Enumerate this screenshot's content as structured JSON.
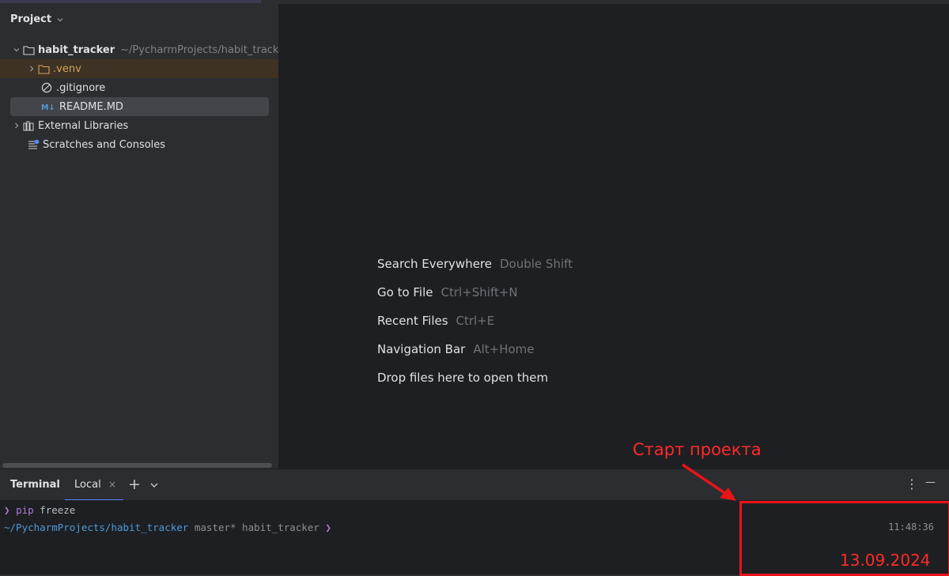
{
  "project_panel": {
    "title": "Project",
    "tree": {
      "root": {
        "label": "habit_tracker",
        "path": "~/PycharmProjects/habit_tracker"
      },
      "items": [
        {
          "label": ".venv"
        },
        {
          "label": ".gitignore"
        },
        {
          "label": "README.MD"
        },
        {
          "label": "External Libraries"
        },
        {
          "label": "Scratches and Consoles"
        }
      ]
    }
  },
  "editor": {
    "hints": [
      {
        "label": "Search Everywhere",
        "shortcut": "Double Shift"
      },
      {
        "label": "Go to File",
        "shortcut": "Ctrl+Shift+N"
      },
      {
        "label": "Recent Files",
        "shortcut": "Ctrl+E"
      },
      {
        "label": "Navigation Bar",
        "shortcut": "Alt+Home"
      },
      {
        "label": "Drop files here to open them",
        "shortcut": ""
      }
    ]
  },
  "terminal": {
    "title": "Terminal",
    "tab": {
      "label": "Local",
      "close": "×"
    },
    "add": "+",
    "dropdown": "⌄",
    "more": "⋮",
    "minimize": "—",
    "lines": {
      "l1_prompt": "❯",
      "l1_cmd": "pip",
      "l1_arg": "freeze",
      "l2_path": "~/PycharmProjects/habit_tracker",
      "l2_branch": "master*",
      "l2_env": "habit_tracker",
      "l2_prompt": "❯"
    },
    "timestamp": "11:48:36"
  },
  "annotation": {
    "label": "Старт проекта",
    "date": "13.09.2024",
    "color": "#e8141a"
  },
  "colors": {
    "accent": "#548af7",
    "folder_orange": "#d6a35a",
    "markdown_blue": "#4f9ad8"
  }
}
